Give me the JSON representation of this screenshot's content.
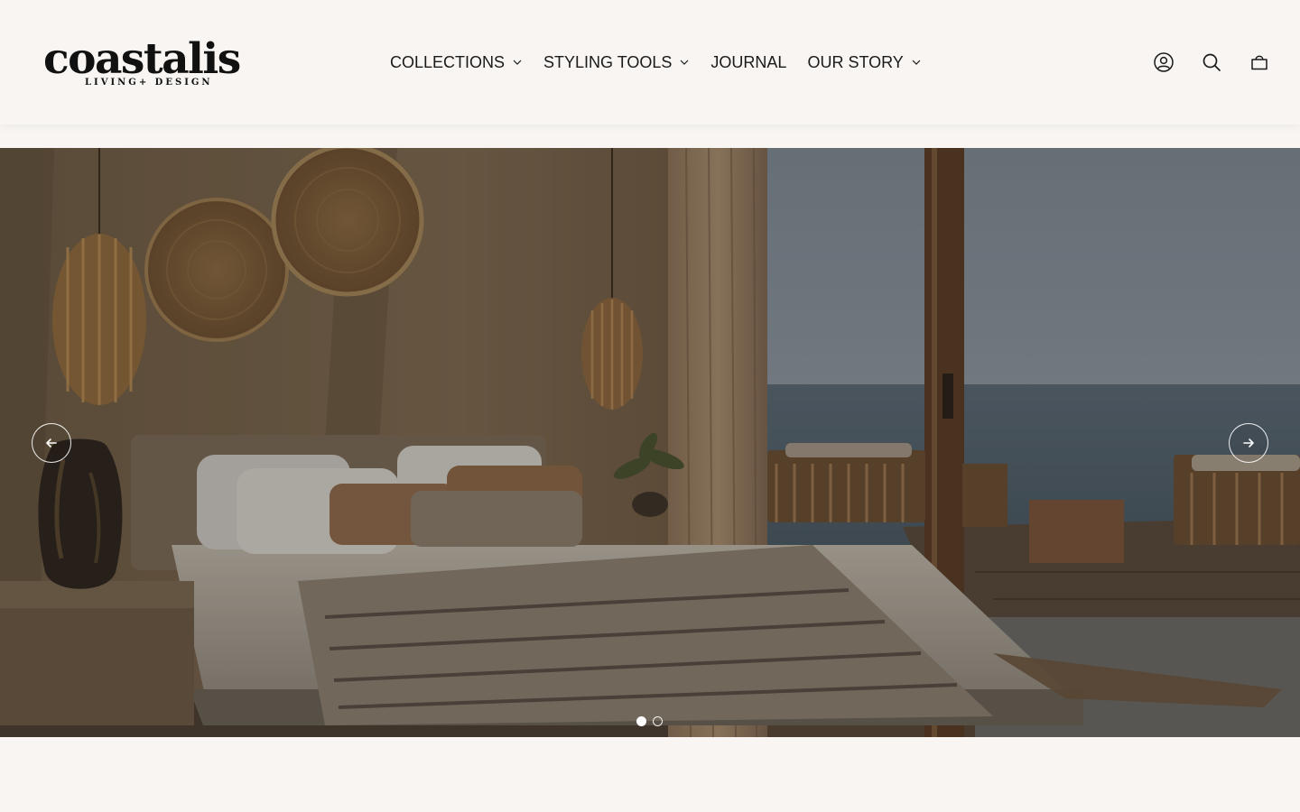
{
  "brand": {
    "name": "coastalis",
    "tagline": "LIVING+ DESIGN"
  },
  "nav": {
    "items": [
      {
        "label": "COLLECTIONS",
        "has_dropdown": true
      },
      {
        "label": "STYLING TOOLS",
        "has_dropdown": true
      },
      {
        "label": "JOURNAL",
        "has_dropdown": false
      },
      {
        "label": "OUR STORY",
        "has_dropdown": true
      }
    ]
  },
  "header_icons": [
    "account-icon",
    "search-icon",
    "cart-icon"
  ],
  "hero": {
    "image_subject": "bedroom-with-ocean-view",
    "slide_count": 2,
    "active_slide": 1,
    "prev_icon": "arrow-left-icon",
    "next_icon": "arrow-right-icon"
  },
  "colors": {
    "background": "#f8f5f2",
    "text": "#1a1a1a"
  }
}
